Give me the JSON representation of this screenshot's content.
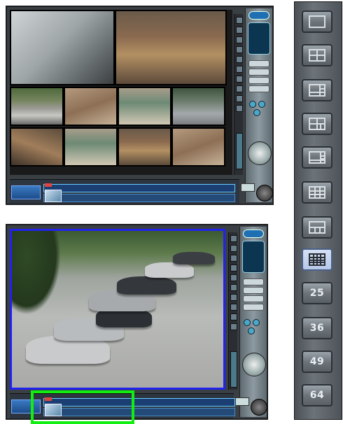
{
  "toolbar": {
    "buttons": [
      {
        "layout": "single",
        "label": ""
      },
      {
        "layout": "quad",
        "label": ""
      },
      {
        "layout": "one-plus-five",
        "label": ""
      },
      {
        "layout": "four-plus-three",
        "label": ""
      },
      {
        "layout": "one-plus-seven",
        "label": ""
      },
      {
        "layout": "nine",
        "label": ""
      },
      {
        "layout": "wide",
        "label": ""
      },
      {
        "layout": "sixteen",
        "label": "",
        "active": true
      },
      {
        "layout": "twenty-five",
        "label": "25"
      },
      {
        "layout": "thirty-six",
        "label": "36"
      },
      {
        "layout": "forty-nine",
        "label": "49"
      },
      {
        "layout": "sixty-four",
        "label": "64"
      }
    ]
  },
  "colors": {
    "highlight_green": "#12ee12",
    "selected_channel_blue": "#2222ee",
    "active_layout": "#b6c8ea"
  },
  "dvr_top": {
    "channels": 10,
    "view": "multi-channel"
  },
  "dvr_bottom": {
    "channels": 1,
    "view": "single-channel"
  }
}
